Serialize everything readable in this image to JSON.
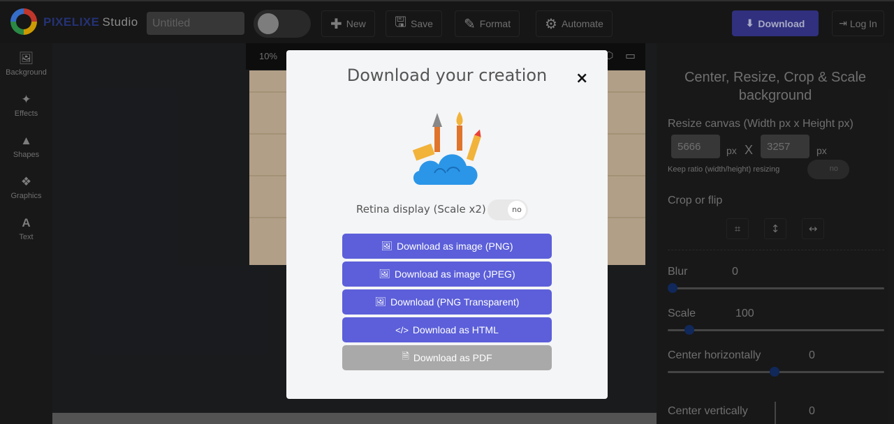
{
  "app": {
    "brand": "PIXELIXE",
    "studio": "Studio",
    "title_placeholder": "Untitled"
  },
  "toolbar": {
    "new": "New",
    "save": "Save",
    "format": "Format",
    "automate": "Automate",
    "download": "Download",
    "login": "Log In"
  },
  "sidebar": {
    "items": [
      {
        "label": "Background",
        "icon": "image-icon"
      },
      {
        "label": "Effects",
        "icon": "magic-wand-icon"
      },
      {
        "label": "Shapes",
        "icon": "shapes-icon"
      },
      {
        "label": "Graphics",
        "icon": "graphics-icon"
      },
      {
        "label": "Text",
        "icon": "text-icon"
      }
    ]
  },
  "canvas": {
    "zoom": "10%"
  },
  "right_panel": {
    "title": "Center, Resize, Crop & Scale background",
    "resize_label": "Resize canvas (Width px x Height px)",
    "width": "5666",
    "height": "3257",
    "px": "px",
    "x": "X",
    "keep_ratio": "Keep ratio (width/height) resizing",
    "keep_ratio_state": "no",
    "crop_label": "Crop or flip",
    "blur_label": "Blur",
    "blur_value": "0",
    "scale_label": "Scale",
    "scale_value": "100",
    "center_h_label": "Center horizontally",
    "center_h_value": "0",
    "center_v_label": "Center vertically",
    "center_v_value": "0"
  },
  "modal": {
    "title": "Download your creation",
    "close": "×",
    "retina_label": "Retina display (Scale x2)",
    "retina_state": "no",
    "buttons": {
      "png": "Download as image (PNG)",
      "jpeg": "Download as image (JPEG)",
      "png_transparent": "Download (PNG Transparent)",
      "html": "Download as HTML",
      "pdf": "Download as PDF"
    }
  },
  "colors": {
    "accent": "#5c5fd9",
    "pdf_button": "#a9a9a9",
    "slider_thumb": "#14316e"
  }
}
